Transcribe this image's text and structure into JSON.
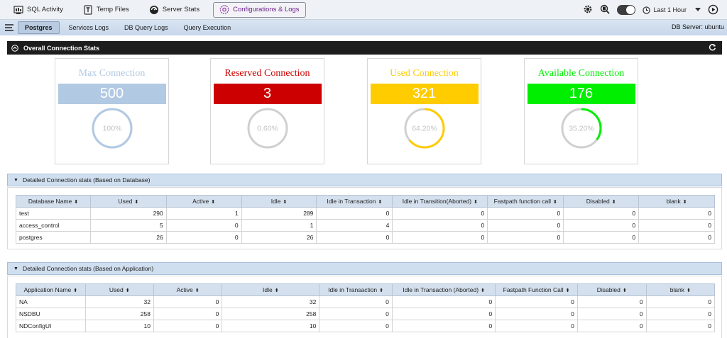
{
  "toolbar": {
    "tabs": [
      {
        "label": "SQL Activity"
      },
      {
        "label": "Temp Files"
      },
      {
        "label": "Server Stats"
      },
      {
        "label": "Configurations & Logs"
      }
    ],
    "time_range": "Last 1 Hour"
  },
  "subnav": {
    "tabs": [
      {
        "label": "Postgres"
      },
      {
        "label": "Services Logs"
      },
      {
        "label": "DB Query Logs"
      },
      {
        "label": "Query Execution"
      }
    ],
    "db_server": "DB Server: ubuntu"
  },
  "overall": {
    "title": "Overall Connection Stats",
    "cards": [
      {
        "title": "Max Connection",
        "value": "500",
        "percent_label": "100%",
        "percent": 100,
        "color": "#b2c9e3"
      },
      {
        "title": "Reserved Connection",
        "value": "3",
        "percent_label": "0.60%",
        "percent": 0.6,
        "color": "#cc0000"
      },
      {
        "title": "Used Connection",
        "value": "321",
        "percent_label": "64.20%",
        "percent": 64.2,
        "color": "#ffcc00"
      },
      {
        "title": "Available Connection",
        "value": "176",
        "percent_label": "35.20%",
        "percent": 35.2,
        "color": "#00ee00"
      }
    ]
  },
  "db_section": {
    "title": "Detailed Connection stats (Based on Database)",
    "headers": [
      "Database Name",
      "Used",
      "Active",
      "Idle",
      "Idle in Transaction",
      "Idle in Transition(Aborted)",
      "Fastpath function call",
      "Disabled",
      "blank"
    ],
    "rows": [
      [
        "test",
        "290",
        "1",
        "289",
        "0",
        "0",
        "0",
        "0",
        "0"
      ],
      [
        "access_control",
        "5",
        "0",
        "1",
        "4",
        "0",
        "0",
        "0",
        "0"
      ],
      [
        "postgres",
        "26",
        "0",
        "26",
        "0",
        "0",
        "0",
        "0",
        "0"
      ]
    ]
  },
  "app_section": {
    "title": "Detailed Connection stats (Based on Application)",
    "headers": [
      "Application Name",
      "Used",
      "Active",
      "Idle",
      "Idle in Transaction",
      "Idle in Transaction (Aborted)",
      "Fastpath Function Call",
      "Disabled",
      "blank"
    ],
    "rows": [
      [
        "NA",
        "32",
        "0",
        "32",
        "0",
        "0",
        "0",
        "0",
        "0"
      ],
      [
        "NSDBU",
        "258",
        "0",
        "258",
        "0",
        "0",
        "0",
        "0",
        "0"
      ],
      [
        "NDConfigUI",
        "10",
        "0",
        "10",
        "0",
        "0",
        "0",
        "0",
        "0"
      ]
    ]
  }
}
